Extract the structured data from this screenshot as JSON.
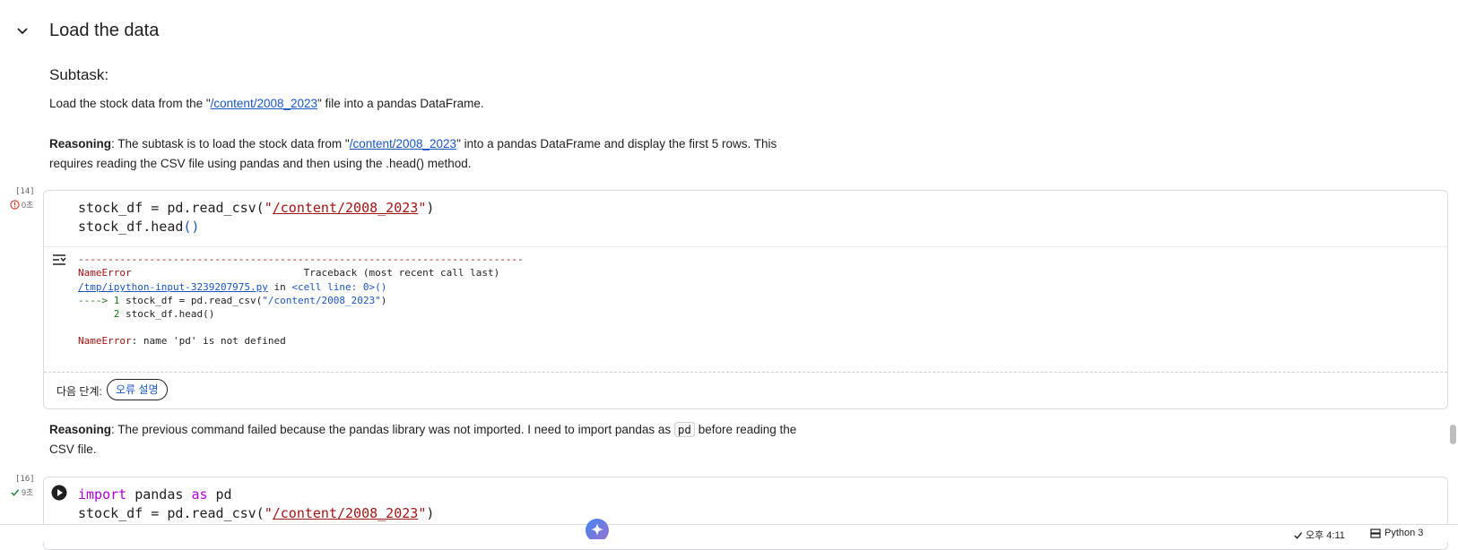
{
  "section": {
    "title": "Load the data"
  },
  "subtask": {
    "heading": "Subtask:",
    "text_before": "Load the stock data from the \"",
    "link": "/content/2008_2023",
    "text_after": "\" file into a pandas DataFrame."
  },
  "reasoning1": {
    "label": "Reasoning",
    "text_before": ": The subtask is to load the stock data from \"",
    "link": "/content/2008_2023",
    "text_after": "\" into a pandas DataFrame and display the first 5 rows. This requires reading the CSV file using pandas and then using the .head() method."
  },
  "cell14": {
    "exec_count": "[14]",
    "status": "0초",
    "line1_prefix": "stock_df = pd.read_csv(",
    "line1_quote_open": "\"",
    "line1_path": "/content/2008_2023",
    "line1_quote_close": "\"",
    "line1_suffix": ")",
    "line2": "stock_df.head",
    "line2_parens": "()",
    "output": {
      "divider": "---------------------------------------------------------------------------",
      "error_name": "NameError",
      "traceback_header": "                             Traceback (most recent call last)",
      "file_link": "/tmp/ipython-input-3239207975.py",
      "in_text": " in ",
      "cell_line": "<cell line: 0>()",
      "arrow": "----> 1",
      "tb_line1_a": " stock_df = pd.read_csv(",
      "tb_line1_b": "\"/content/2008_2023\"",
      "tb_line1_c": ")",
      "tb_line2_num": "      2",
      "tb_line2": " stock_df.head()",
      "final_error_name": "NameError",
      "final_error_msg": ": name 'pd' is not defined"
    },
    "next_steps_label": "다음 단계:",
    "explain_error_label": "오류 설명"
  },
  "reasoning2": {
    "label": "Reasoning",
    "text_before": ": The previous command failed because the pandas library was not imported. I need to import pandas as ",
    "code": "pd",
    "text_after": " before reading the CSV file."
  },
  "cell16": {
    "exec_count": "[16]",
    "status": "9초",
    "line1_kw1": "import",
    "line1_mid": " pandas ",
    "line1_kw2": "as",
    "line1_end": " pd",
    "line2_prefix": "stock_df = pd.read_csv(",
    "line2_quote_open": "\"",
    "line2_path": "/content/2008_2023",
    "line2_quote_close": "\"",
    "line2_suffix": ")"
  },
  "status_bar": {
    "time": "오후 4:11",
    "runtime": "Python 3"
  },
  "colors": {
    "accent_blue": "#1a56c4",
    "error_red": "#d93025",
    "success_green": "#188038",
    "string_red": "#a31515",
    "keyword_purple": "#af00db"
  },
  "icons": {
    "collapse": "chevron-down-icon",
    "error_status": "error-circle-icon",
    "success_status": "check-icon",
    "output_toggle": "output-toggle-icon",
    "run": "play-icon",
    "gemini": "gemini-sparkle-icon",
    "runtime": "server-icon"
  }
}
